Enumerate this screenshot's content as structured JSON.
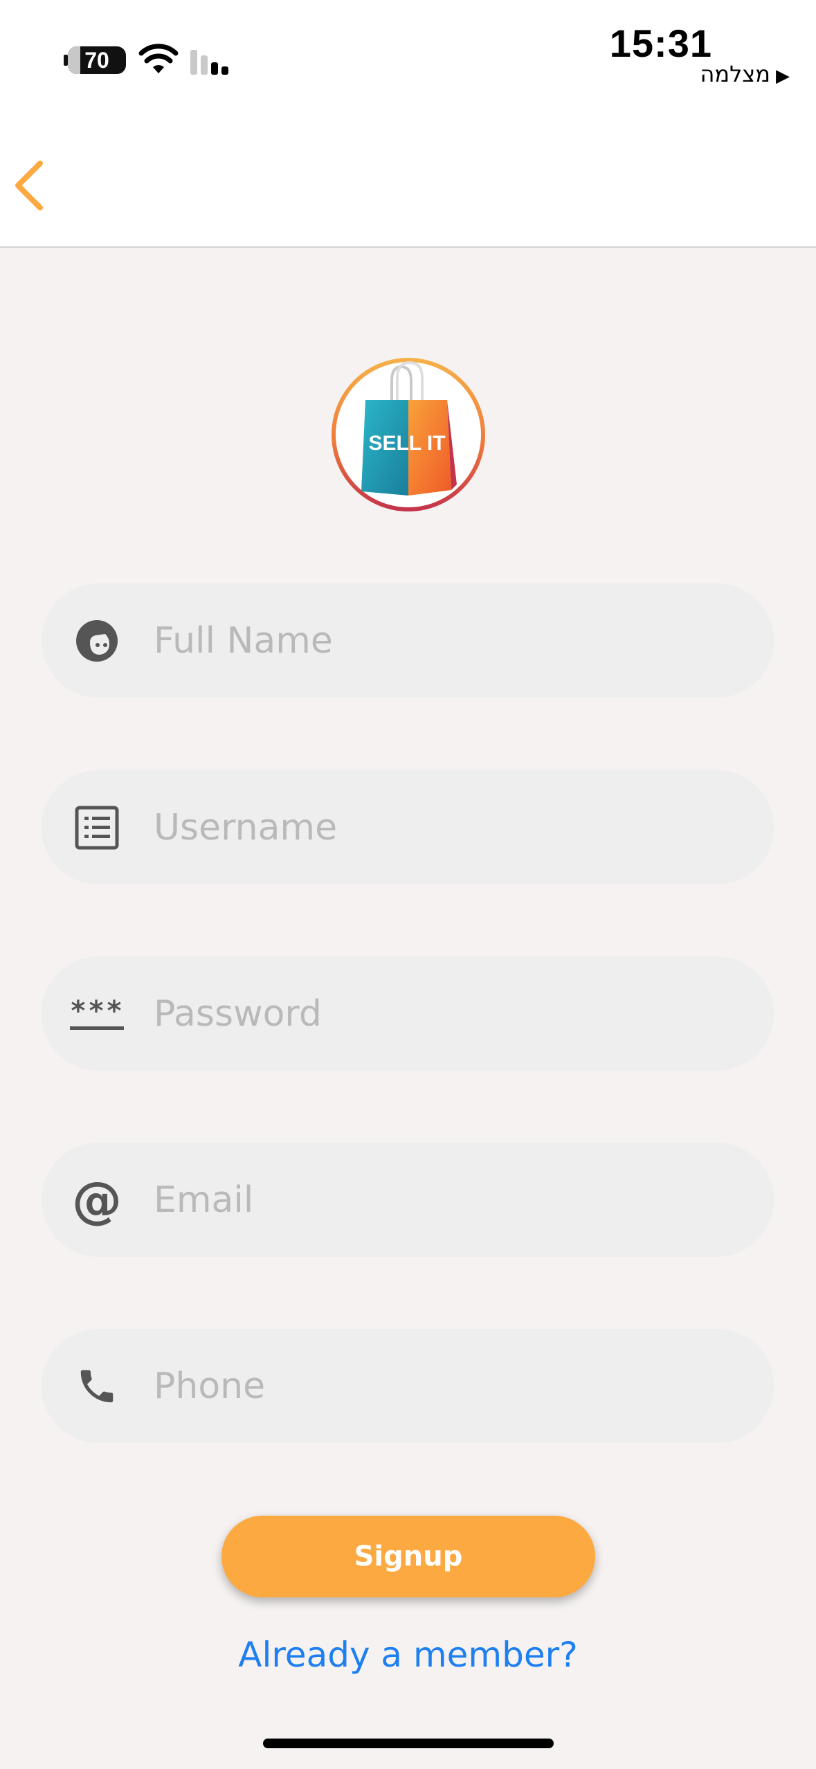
{
  "status_bar": {
    "battery_level": "70",
    "time": "15:31",
    "carrier_text": "מצלמה",
    "back_to_app_indicator": "▶"
  },
  "nav": {
    "back_icon": "chevron-left-icon",
    "accent_color": "#fda942"
  },
  "logo": {
    "text": "SELL IT"
  },
  "form": {
    "fields": [
      {
        "placeholder": "Full Name",
        "value": "",
        "icon": "user-face-icon"
      },
      {
        "placeholder": "Username",
        "value": "",
        "icon": "list-icon"
      },
      {
        "placeholder": "Password",
        "value": "",
        "icon": "password-asterisks-icon"
      },
      {
        "placeholder": "Email",
        "value": "",
        "icon": "at-sign-icon"
      },
      {
        "placeholder": "Phone",
        "value": "",
        "icon": "phone-icon"
      }
    ],
    "password_icon_glyph": "***",
    "email_icon_glyph": "@"
  },
  "actions": {
    "signup_label": "Signup",
    "signup_color": "#fda942",
    "member_link": "Already a member?",
    "member_link_color": "#1e7ff0"
  }
}
